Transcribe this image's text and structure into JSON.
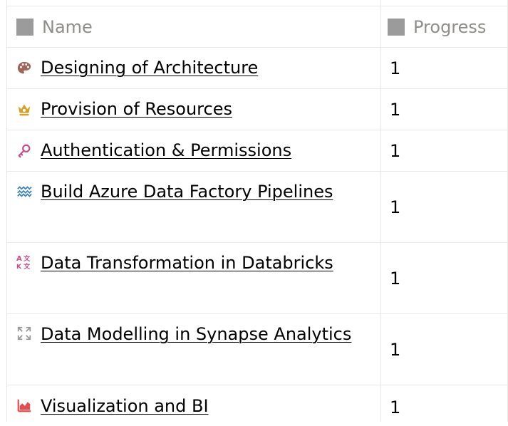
{
  "columns": {
    "name": "Name",
    "progress": "Progress"
  },
  "rows": [
    {
      "icon": "palette-icon",
      "name": "Designing of Architecture",
      "progress": "1"
    },
    {
      "icon": "crown-icon",
      "name": "Provision of Resources",
      "progress": "1"
    },
    {
      "icon": "key-icon",
      "name": "Authentication & Permissions",
      "progress": "1"
    },
    {
      "icon": "waves-icon",
      "name": "Build Azure Data Factory Pipelines",
      "progress": "1"
    },
    {
      "icon": "translate-icon",
      "name": "Data Transformation in Databricks",
      "progress": "1"
    },
    {
      "icon": "expand-icon",
      "name": "Data Modelling in Synapse Analytics",
      "progress": "1"
    },
    {
      "icon": "chart-area-icon",
      "name": "Visualization and BI",
      "progress": "1"
    }
  ]
}
